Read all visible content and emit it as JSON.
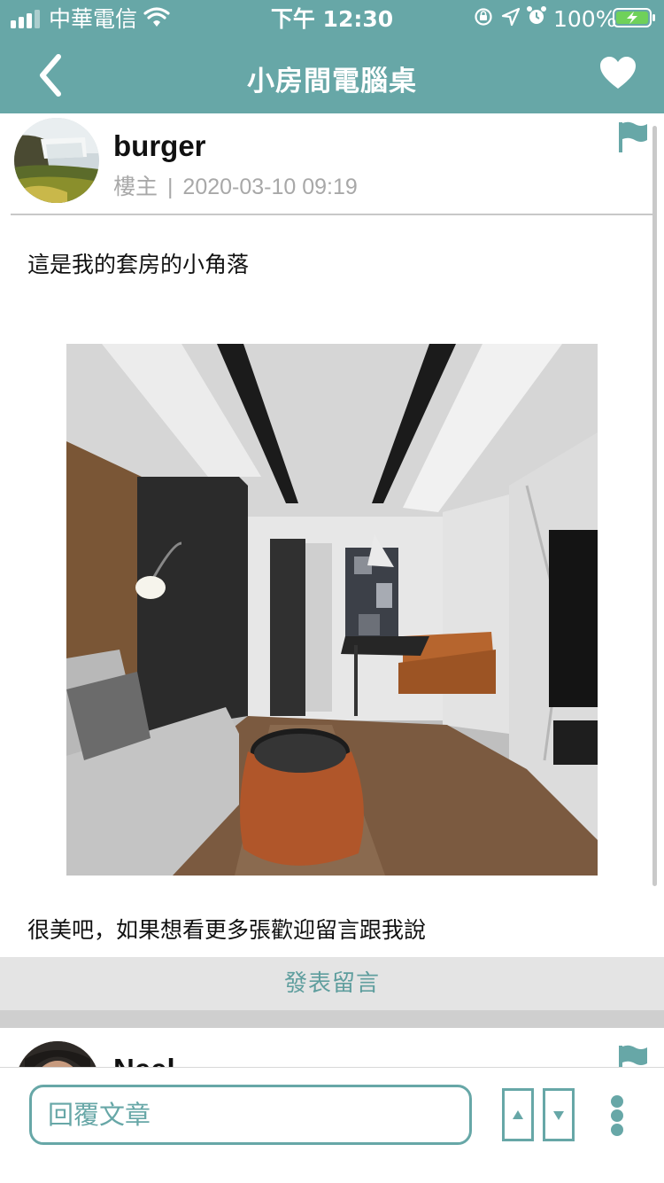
{
  "status_bar": {
    "carrier": "中華電信",
    "time": "下午 12:30",
    "battery": "100%"
  },
  "header": {
    "title": "小房間電腦桌"
  },
  "post": {
    "username": "burger",
    "role": "樓主",
    "separator": "|",
    "timestamp": "2020-03-10 09:19",
    "text_1": "這是我的套房的小角落",
    "text_2": "很美吧，如果想看更多張歡迎留言跟我說",
    "reply_button": "發表留言"
  },
  "next_post": {
    "username": "Neel"
  },
  "footer": {
    "reply_placeholder": "回覆文章"
  },
  "colors": {
    "accent": "#67a7a7",
    "reply_text": "#5f9e9e",
    "meta_gray": "#a8a8a8",
    "battery_green": "#6fd15a"
  }
}
